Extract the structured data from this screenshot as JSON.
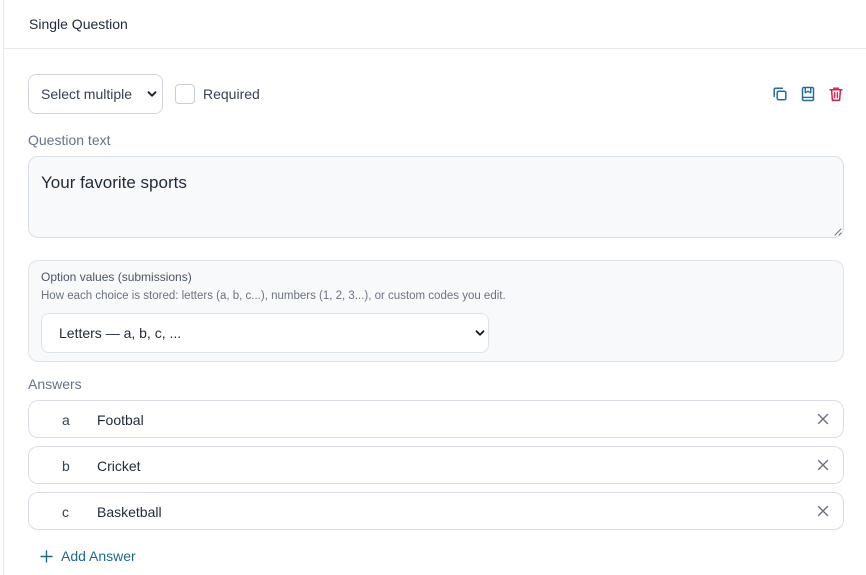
{
  "header": {
    "title": "Single Question"
  },
  "toolbar": {
    "type_value": "Select multiple",
    "required_label": "Required",
    "action_icons": [
      "copy-icon",
      "save-icon",
      "delete-icon"
    ],
    "delete_color": "#e11d48",
    "action_color": "#1f6f99"
  },
  "question": {
    "label": "Question text",
    "value": "Your favorite sports"
  },
  "option_values": {
    "title": "Option values (submissions)",
    "help": "How each choice is stored: letters (a, b, c...), numbers (1, 2, 3...), or custom codes you edit.",
    "selected": "Letters — a, b, c, ..."
  },
  "answers": {
    "label": "Answers",
    "items": [
      {
        "key": "a",
        "text": "Footbal"
      },
      {
        "key": "b",
        "text": "Cricket"
      },
      {
        "key": "c",
        "text": "Basketball"
      }
    ],
    "add_label": "Add Answer"
  }
}
